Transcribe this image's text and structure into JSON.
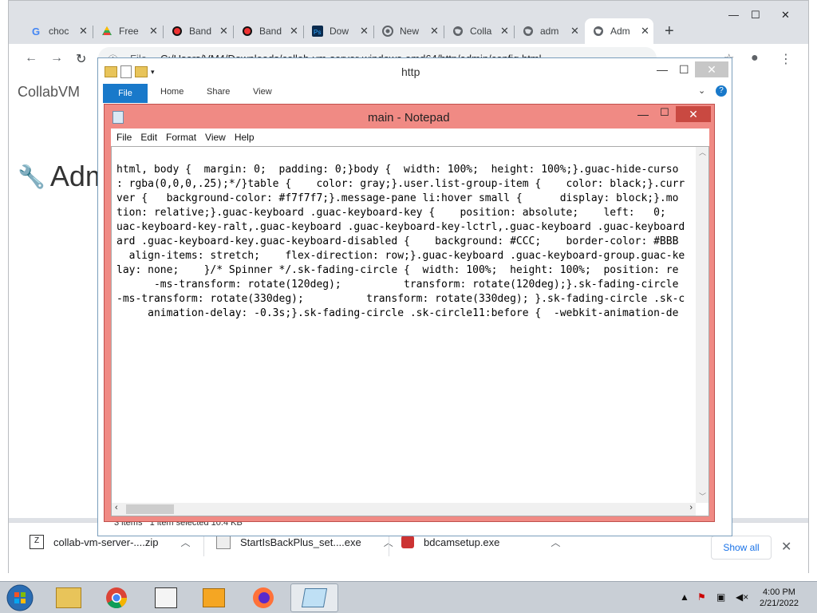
{
  "browser": {
    "tabs": [
      {
        "title": "choc",
        "icon": "google-icon"
      },
      {
        "title": "Free",
        "icon": "drive-icon"
      },
      {
        "title": "Band",
        "icon": "record-icon"
      },
      {
        "title": "Band",
        "icon": "record-icon"
      },
      {
        "title": "Dow",
        "icon": "photoshop-icon"
      },
      {
        "title": "New",
        "icon": "chrome-icon"
      },
      {
        "title": "Colla",
        "icon": "globe-icon"
      },
      {
        "title": "adm",
        "icon": "globe-icon"
      },
      {
        "title": "Adm",
        "icon": "globe-icon",
        "active": true
      }
    ],
    "tab_close": "✕",
    "new_tab": "+",
    "address": {
      "label": "File",
      "url": "C:/Users/VM4/Downloads/collab-vm-server-windows-amd64/http/admin/config.html"
    }
  },
  "page": {
    "brand": "CollabVM",
    "heading": "Adm"
  },
  "downloads": {
    "items": [
      {
        "name": "collab-vm-server-....zip",
        "icon": "zip-icon"
      },
      {
        "name": "StartIsBackPlus_set....exe",
        "icon": "exe-icon"
      },
      {
        "name": "bdcamsetup.exe",
        "icon": "bandicam-icon"
      }
    ],
    "show_all": "Show all",
    "close": "✕"
  },
  "explorer": {
    "title": "http",
    "ribbon_tabs": [
      "File",
      "Home",
      "Share",
      "View"
    ],
    "status_items": "3 items",
    "status_selected": "1 item selected  10.4 KB"
  },
  "notepad": {
    "title": "main - Notepad",
    "menu": [
      "File",
      "Edit",
      "Format",
      "View",
      "Help"
    ],
    "lines": [
      "html, body {  margin: 0;  padding: 0;}body {  width: 100%;  height: 100%;}.guac-hide-curso",
      ": rgba(0,0,0,.25);*/}table {    color: gray;}.user.list-group-item {    color: black;}.curr",
      "ver {   background-color: #f7f7f7;}.message-pane li:hover small {      display: block;}.mo",
      "tion: relative;}.guac-keyboard .guac-keyboard-key {    position: absolute;    left:   0;",
      "uac-keyboard-key-ralt,.guac-keyboard .guac-keyboard-key-lctrl,.guac-keyboard .guac-keyboard",
      "ard .guac-keyboard-key.guac-keyboard-disabled {    background: #CCC;    border-color: #BBB",
      "  align-items: stretch;    flex-direction: row;}.guac-keyboard .guac-keyboard-group.guac-ke",
      "lay: none;    }/* Spinner */.sk-fading-circle {  width: 100%;  height: 100%;  position: re",
      "      -ms-transform: rotate(120deg);          transform: rotate(120deg);}.sk-fading-circle",
      "-ms-transform: rotate(330deg);          transform: rotate(330deg); }.sk-fading-circle .sk-c",
      "     animation-delay: -0.3s;}.sk-fading-circle .sk-circle11:before {  -webkit-animation-de"
    ]
  },
  "taskbar": {
    "apps": [
      "start-button",
      "explorer-icon",
      "chrome-icon",
      "notepad-icon",
      "media-player-icon",
      "firefox-icon",
      "notepad-active-icon"
    ],
    "time": "4:00 PM",
    "date": "2/21/2022"
  }
}
